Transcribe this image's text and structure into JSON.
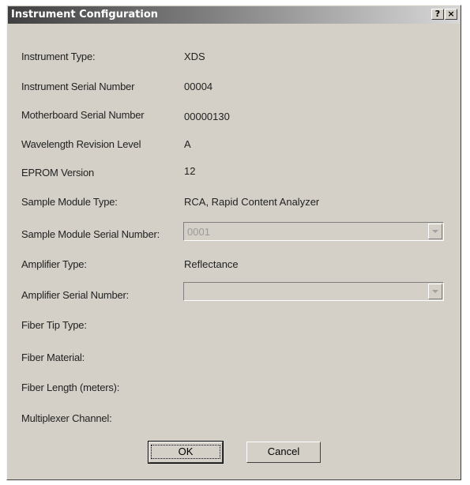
{
  "window": {
    "title": "Instrument Configuration",
    "help_label": "?",
    "close_label": "×"
  },
  "fields": {
    "instrument_type": {
      "label": "Instrument Type:",
      "value": "XDS"
    },
    "instrument_serial": {
      "label": "Instrument Serial Number",
      "value": "00004"
    },
    "motherboard_serial": {
      "label": "Motherboard Serial Number",
      "value": "00000130"
    },
    "wavelength_revision": {
      "label": "Wavelength Revision Level",
      "value": "A"
    },
    "eprom_version": {
      "label": "EPROM Version",
      "value": "12"
    },
    "sample_module_type": {
      "label": "Sample Module Type:",
      "value": "RCA, Rapid Content Analyzer"
    },
    "sample_module_serial": {
      "label": "Sample Module Serial Number:",
      "value": "0001"
    },
    "amplifier_type": {
      "label": "Amplifier Type:",
      "value": "Reflectance"
    },
    "amplifier_serial": {
      "label": "Amplifier Serial Number:",
      "value": ""
    },
    "fiber_tip_type": {
      "label": "Fiber Tip Type:"
    },
    "fiber_material": {
      "label": "Fiber Material:"
    },
    "fiber_length": {
      "label": "Fiber Length (meters):"
    },
    "multiplexer_channel": {
      "label": "Multiplexer Channel:"
    }
  },
  "buttons": {
    "ok": "OK",
    "cancel": "Cancel"
  },
  "icons": {
    "help": "help-icon",
    "close": "close-icon",
    "dropdown": "chevron-down-icon"
  }
}
